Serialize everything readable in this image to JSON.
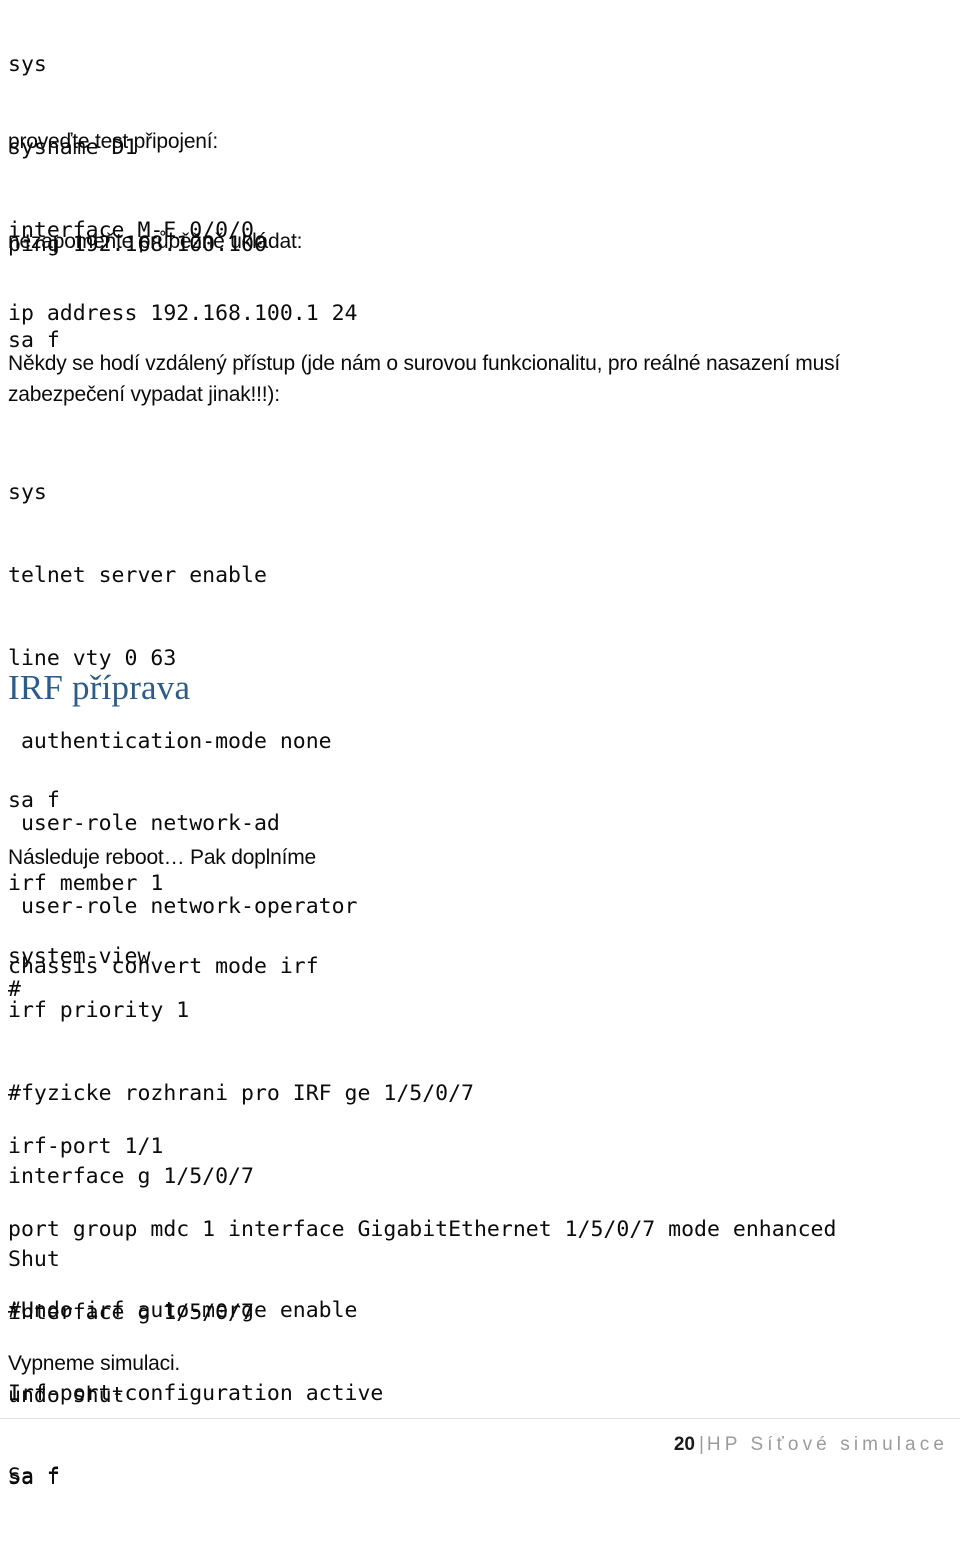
{
  "document": {
    "language": "cs",
    "heading_color": "#2E5C8A",
    "blocks": [
      {
        "id": "cfg-sysname",
        "type": "code",
        "lines": [
          "sys",
          "sysname D1",
          "interface M-E 0/0/0",
          "ip address 192.168.100.1 24"
        ]
      },
      {
        "id": "note-test",
        "type": "prose",
        "lines": [
          "proveďte test připojení:"
        ]
      },
      {
        "id": "cfg-ping",
        "type": "code",
        "lines": [
          "ping 192.168.100.100"
        ]
      },
      {
        "id": "note-save",
        "type": "prose",
        "lines": [
          "nezapomeňte průběžně ukládat:"
        ]
      },
      {
        "id": "cfg-save",
        "type": "code",
        "lines": [
          "sa f"
        ]
      },
      {
        "id": "note-remote",
        "type": "prose",
        "lines": [
          "Někdy se hodí vzdálený přístup (jde nám o surovou funkcionalitu, pro reálné nasazení musí",
          "zabezpečení vypadat jinak!!!):"
        ]
      },
      {
        "id": "cfg-telnet",
        "type": "code",
        "lines": [
          "sys",
          "telnet server enable",
          "line vty 0 63",
          " authentication-mode none",
          " user-role network-ad",
          " user-role network-operator",
          "#"
        ]
      },
      {
        "id": "heading-irf",
        "type": "heading",
        "text": "IRF příprava"
      },
      {
        "id": "cfg-irf-prep",
        "type": "code",
        "lines": [
          "sa f",
          "irf member 1",
          "chassis convert mode irf"
        ]
      },
      {
        "id": "note-reboot",
        "type": "prose",
        "lines": [
          "Následuje reboot… Pak doplníme"
        ]
      },
      {
        "id": "cfg-system-view",
        "type": "code",
        "lines": [
          "system-view"
        ]
      },
      {
        "id": "cfg-irf-priority",
        "type": "code",
        "lines": [
          "irf priority 1",
          "#fyzicke rozhrani pro IRF ge 1/5/0/7",
          "interface g 1/5/0/7",
          "Shut"
        ]
      },
      {
        "id": "cfg-irf-port",
        "type": "code",
        "lines": [
          "irf-port 1/1",
          "port group mdc 1 interface GigabitEthernet 1/5/0/7 mode enhanced",
          "interface g 1/5/0/7",
          "undo shut",
          "sa f"
        ]
      },
      {
        "id": "cfg-irf-activate",
        "type": "code",
        "lines": [
          "#Undo irf auto-merge enable",
          "Irf-port-configuration active",
          "Sa f"
        ]
      },
      {
        "id": "note-stop",
        "type": "prose",
        "lines": [
          "Vypneme simulaci."
        ]
      }
    ]
  },
  "footer": {
    "page_number": "20",
    "separator": "|",
    "doc_title": "HP Síťové simulace"
  }
}
